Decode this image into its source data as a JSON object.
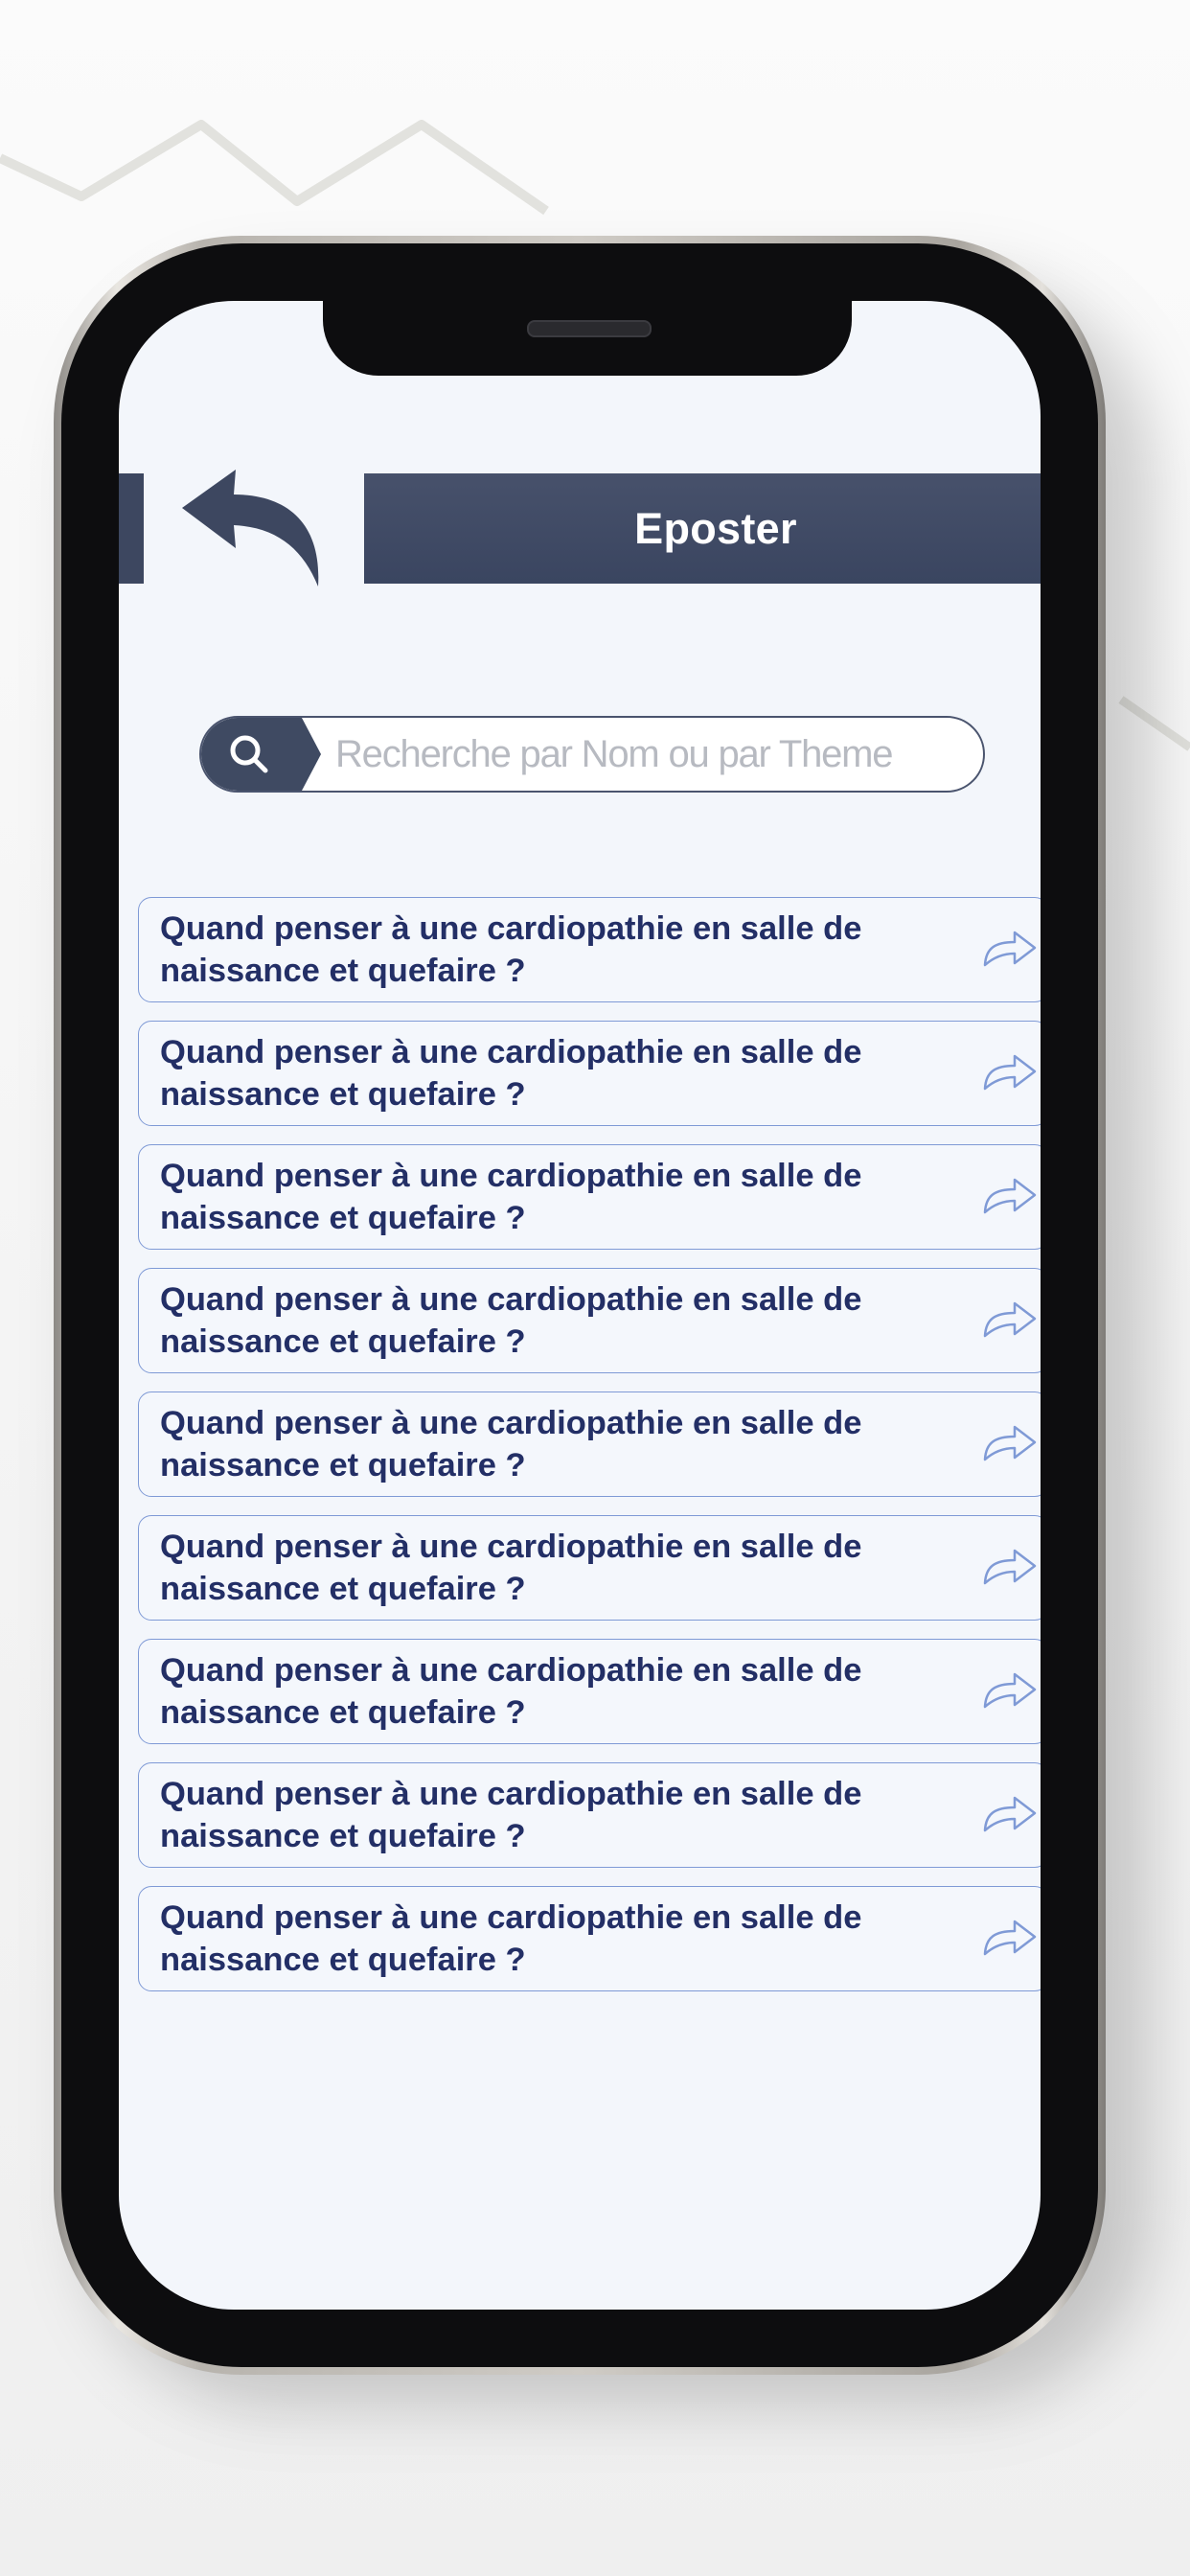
{
  "header": {
    "title": "Eposter",
    "back_icon": "back-arrow-icon"
  },
  "search": {
    "placeholder": "Recherche par Nom ou par Theme",
    "value": "",
    "icon": "search-icon"
  },
  "items": [
    {
      "line1": "Quand penser à une cardiopathie en salle de",
      "line2": "naissance et quefaire ?",
      "icon": "share-arrow-icon"
    },
    {
      "line1": "Quand penser à une cardiopathie en salle de",
      "line2": "naissance et quefaire ?",
      "icon": "share-arrow-icon"
    },
    {
      "line1": "Quand penser à une cardiopathie en salle de",
      "line2": "naissance et quefaire ?",
      "icon": "share-arrow-icon"
    },
    {
      "line1": "Quand penser à une cardiopathie en salle de",
      "line2": "naissance et quefaire ?",
      "icon": "share-arrow-icon"
    },
    {
      "line1": "Quand penser à une cardiopathie en salle de",
      "line2": "naissance et quefaire ?",
      "icon": "share-arrow-icon"
    },
    {
      "line1": "Quand penser à une cardiopathie en salle de",
      "line2": "naissance et quefaire ?",
      "icon": "share-arrow-icon"
    },
    {
      "line1": "Quand penser à une cardiopathie en salle de",
      "line2": "naissance et quefaire ?",
      "icon": "share-arrow-icon"
    },
    {
      "line1": "Quand penser à une cardiopathie en salle de",
      "line2": "naissance et quefaire ?",
      "icon": "share-arrow-icon"
    },
    {
      "line1": "Quand penser à une cardiopathie en salle de",
      "line2": "naissance et quefaire ?",
      "icon": "share-arrow-icon"
    }
  ],
  "colors": {
    "header_bar": "#3d4760",
    "item_text": "#232f66",
    "item_border": "#7f9ad6",
    "screen_background": "#f3f6fb"
  }
}
